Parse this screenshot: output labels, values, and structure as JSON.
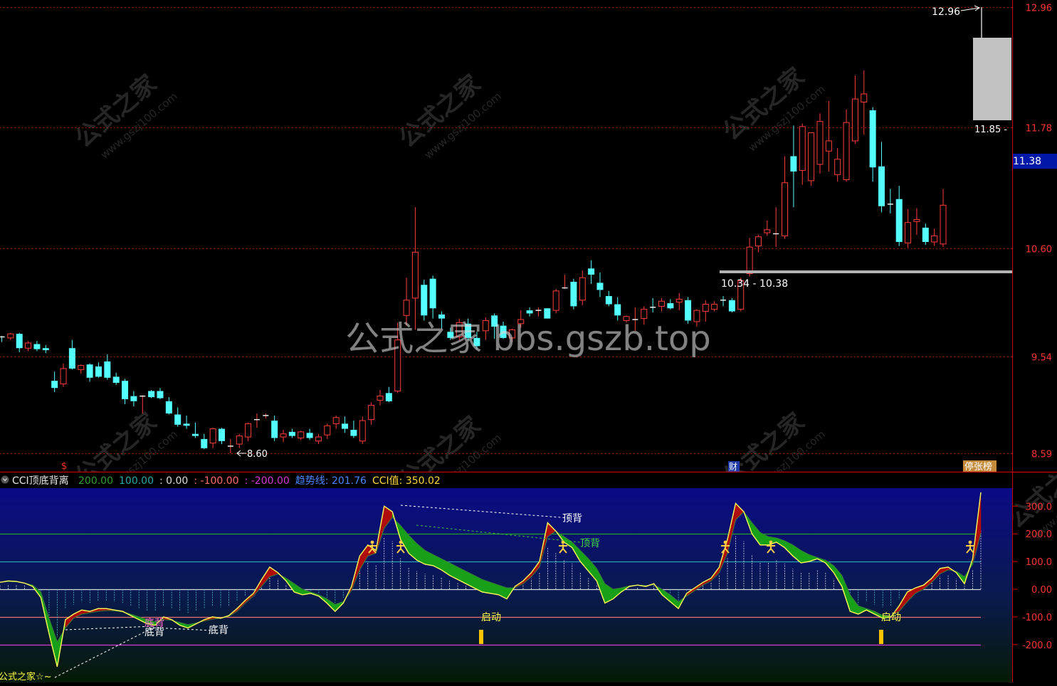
{
  "colors": {
    "up": "#ff3c3c",
    "down": "#54ffff",
    "axis": "#e00000",
    "grid": "#8b0000",
    "price_label": "#ff3434",
    "current_price_bg": "#0018a8",
    "indicator_bg_top": "#0a0a86",
    "indicator_bg_bottom": "#061a06",
    "cci_line": "#ffff55",
    "fill_up": "#b00c0c",
    "fill_down": "#18a018",
    "text_white": "#ffffff",
    "text_yellow": "#ffff44"
  },
  "price_panel": {
    "y_axis_labels": [
      "12.96",
      "11.78",
      "10.60",
      "9.54",
      "8.59"
    ],
    "current_price": "11.38",
    "high_marker": "12.96",
    "low_marker": "8.60",
    "level_marker": "11.85 -",
    "support_line_label": "10.34 - 10.38",
    "bottom_tags": {
      "left": "$",
      "mid": "财",
      "right": "停张榜"
    }
  },
  "watermark": {
    "main": "公式之家 bbs.gszb.top",
    "diagonal_cn": "公式之家",
    "diagonal_url": "www.gszj100.com"
  },
  "indicator_panel": {
    "title": "CCI顶底背离",
    "values": [
      {
        "text": "200.00",
        "color": "#2f9f2f"
      },
      {
        "text": "100.00",
        "color": "#27a7a7"
      },
      {
        "text": ": 0.00",
        "color": "#dddddd"
      },
      {
        "text": ": -100.00",
        "color": "#ff6a6a"
      },
      {
        "text": ": -200.00",
        "color": "#d23ad2"
      },
      {
        "text": "趋势线: 201.76",
        "color": "#4a86ff"
      },
      {
        "text": "CCI值: 350.02",
        "color": "#ffd93a"
      }
    ],
    "y_axis_labels": [
      "300.0",
      "200.0",
      "100.0",
      "0.00",
      "-100.0",
      "-200.0"
    ],
    "signals": {
      "top_divergence": "顶背",
      "bottom_divergence": "底背",
      "bottom_divergence_pink": "底背",
      "start": "启动"
    },
    "footer_label": "公式之家☆~"
  },
  "chart_data": [
    {
      "type": "candlestick",
      "title": "",
      "ylim": [
        8.5,
        13.1
      ],
      "y_ticks": [
        12.96,
        11.78,
        10.6,
        9.54,
        8.59
      ],
      "x": [
        1,
        2,
        3,
        4,
        5,
        6,
        7,
        8,
        9,
        10,
        11,
        12,
        13,
        14,
        15,
        16,
        17,
        18,
        19,
        20,
        21,
        22,
        23,
        24,
        25,
        26,
        27,
        28,
        29,
        30,
        31,
        32,
        33,
        34,
        35,
        36,
        37,
        38,
        39,
        40,
        41,
        42,
        43,
        44,
        45,
        46,
        47,
        48,
        49,
        50,
        51,
        52,
        53,
        54,
        55,
        56,
        57,
        58,
        59,
        60,
        61,
        62,
        63,
        64,
        65,
        66,
        67,
        68,
        69,
        70,
        71,
        72,
        73,
        74,
        75,
        76,
        77,
        78,
        79,
        80,
        81,
        82,
        83,
        84,
        85,
        86,
        87,
        88,
        89,
        90,
        91,
        92,
        93,
        94,
        95,
        96,
        97,
        98,
        99,
        100,
        101,
        102,
        103,
        104,
        105,
        106,
        107,
        108,
        109,
        110,
        111
      ],
      "ohlc": [
        [
          9.73,
          9.74,
          9.68,
          9.72
        ],
        [
          9.72,
          9.77,
          9.7,
          9.76
        ],
        [
          9.76,
          9.77,
          9.58,
          9.62
        ],
        [
          9.62,
          9.69,
          9.59,
          9.67
        ],
        [
          9.66,
          9.69,
          9.59,
          9.61
        ],
        [
          9.62,
          9.65,
          9.57,
          9.6
        ],
        [
          9.3,
          9.39,
          9.19,
          9.23
        ],
        [
          9.27,
          9.47,
          9.24,
          9.42
        ],
        [
          9.62,
          9.7,
          9.41,
          9.42
        ],
        [
          9.41,
          9.46,
          9.37,
          9.45
        ],
        [
          9.46,
          9.47,
          9.29,
          9.33
        ],
        [
          9.44,
          9.48,
          9.33,
          9.34
        ],
        [
          9.49,
          9.56,
          9.31,
          9.33
        ],
        [
          9.34,
          9.38,
          9.26,
          9.28
        ],
        [
          9.3,
          9.32,
          9.07,
          9.12
        ],
        [
          9.15,
          9.2,
          9.05,
          9.1
        ],
        [
          9.15,
          9.16,
          8.98,
          9.15
        ],
        [
          9.2,
          9.21,
          9.13,
          9.14
        ],
        [
          9.2,
          9.23,
          9.12,
          9.13
        ],
        [
          9.1,
          9.14,
          8.97,
          8.98
        ],
        [
          8.97,
          9.04,
          8.85,
          8.87
        ],
        [
          8.88,
          8.96,
          8.83,
          8.86
        ],
        [
          8.78,
          8.89,
          8.74,
          8.76
        ],
        [
          8.73,
          8.78,
          8.63,
          8.64
        ],
        [
          8.69,
          8.84,
          8.64,
          8.83
        ],
        [
          8.83,
          8.84,
          8.68,
          8.71
        ],
        [
          8.65,
          8.73,
          8.59,
          8.66
        ],
        [
          8.68,
          8.78,
          8.64,
          8.76
        ],
        [
          8.75,
          8.89,
          8.71,
          8.88
        ],
        [
          8.92,
          8.98,
          8.84,
          8.92
        ],
        [
          8.96,
          8.98,
          8.93,
          8.96
        ],
        [
          8.91,
          8.96,
          8.71,
          8.74
        ],
        [
          8.75,
          8.82,
          8.7,
          8.78
        ],
        [
          8.8,
          8.83,
          8.74,
          8.76
        ],
        [
          8.74,
          8.81,
          8.72,
          8.8
        ],
        [
          8.79,
          8.83,
          8.72,
          8.74
        ],
        [
          8.71,
          8.78,
          8.68,
          8.75
        ],
        [
          8.77,
          8.88,
          8.73,
          8.86
        ],
        [
          8.88,
          8.96,
          8.83,
          8.94
        ],
        [
          8.88,
          8.95,
          8.79,
          8.83
        ],
        [
          8.82,
          8.91,
          8.74,
          8.76
        ],
        [
          8.71,
          8.95,
          8.68,
          8.91
        ],
        [
          8.92,
          9.09,
          8.87,
          9.06
        ],
        [
          9.11,
          9.21,
          9.06,
          9.15
        ],
        [
          9.18,
          9.24,
          9.09,
          9.1
        ],
        [
          9.2,
          9.87,
          9.18,
          9.7
        ],
        [
          9.94,
          10.31,
          9.84,
          10.09
        ],
        [
          10.11,
          11.0,
          9.8,
          10.56
        ],
        [
          10.24,
          10.29,
          9.89,
          9.94
        ],
        [
          10.3,
          10.33,
          9.91,
          10.01
        ],
        [
          9.95,
          9.98,
          9.81,
          9.91
        ],
        [
          9.78,
          9.82,
          9.7,
          9.72
        ],
        [
          9.73,
          9.91,
          9.7,
          9.87
        ],
        [
          9.86,
          9.91,
          9.7,
          9.72
        ],
        [
          9.72,
          9.78,
          9.61,
          9.64
        ],
        [
          9.79,
          9.92,
          9.7,
          9.89
        ],
        [
          9.94,
          9.96,
          9.71,
          9.83
        ],
        [
          9.84,
          9.88,
          9.71,
          9.72
        ],
        [
          9.72,
          9.81,
          9.68,
          9.8
        ],
        [
          9.86,
          9.99,
          9.82,
          9.9
        ],
        [
          9.99,
          10.02,
          9.93,
          9.96
        ],
        [
          9.99,
          10.02,
          9.93,
          9.99
        ],
        [
          10.01,
          10.01,
          9.91,
          9.91
        ],
        [
          9.99,
          10.2,
          9.96,
          10.18
        ],
        [
          10.21,
          10.34,
          10.2,
          10.21
        ],
        [
          10.27,
          10.3,
          10.0,
          10.03
        ],
        [
          10.09,
          10.38,
          10.04,
          10.31
        ],
        [
          10.4,
          10.48,
          10.25,
          10.34
        ],
        [
          10.26,
          10.36,
          10.12,
          10.19
        ],
        [
          10.13,
          10.18,
          10.03,
          10.05
        ],
        [
          10.05,
          10.12,
          9.89,
          9.94
        ],
        [
          9.89,
          9.94,
          9.87,
          9.93
        ],
        [
          9.89,
          10.02,
          9.79,
          9.9
        ],
        [
          9.91,
          10.03,
          9.85,
          10.0
        ],
        [
          10.02,
          10.11,
          9.97,
          10.01
        ],
        [
          10.03,
          10.11,
          9.98,
          10.08
        ],
        [
          10.06,
          10.1,
          10.0,
          10.01
        ],
        [
          10.07,
          10.16,
          9.99,
          10.1
        ],
        [
          10.09,
          10.12,
          9.86,
          9.89
        ],
        [
          9.88,
          10.0,
          9.83,
          9.99
        ],
        [
          9.98,
          10.09,
          9.88,
          10.05
        ],
        [
          10.0,
          10.08,
          9.98,
          10.05
        ],
        [
          10.09,
          10.13,
          10.03,
          10.08
        ],
        [
          10.09,
          10.11,
          9.97,
          9.98
        ],
        [
          10.0,
          10.31,
          9.98,
          10.28
        ],
        [
          10.35,
          10.7,
          10.32,
          10.61
        ],
        [
          10.62,
          10.73,
          10.56,
          10.71
        ],
        [
          10.75,
          10.87,
          10.72,
          10.78
        ],
        [
          10.74,
          11.0,
          10.61,
          10.74
        ],
        [
          10.72,
          11.5,
          10.69,
          11.24
        ],
        [
          11.5,
          11.8,
          11.0,
          11.35
        ],
        [
          11.36,
          11.82,
          11.22,
          11.79
        ],
        [
          11.26,
          11.72,
          11.21,
          11.73
        ],
        [
          11.42,
          11.92,
          11.33,
          11.84
        ],
        [
          11.55,
          12.04,
          11.35,
          11.65
        ],
        [
          11.32,
          11.58,
          11.25,
          11.47
        ],
        [
          11.27,
          11.96,
          11.25,
          11.83
        ],
        [
          11.65,
          12.29,
          11.62,
          12.06
        ],
        [
          12.03,
          12.34,
          11.71,
          12.11
        ],
        [
          11.95,
          11.98,
          11.25,
          11.39
        ],
        [
          11.4,
          11.64,
          10.95,
          11.01
        ],
        [
          11.03,
          11.18,
          10.94,
          11.02
        ],
        [
          11.08,
          11.21,
          10.62,
          10.66
        ],
        [
          10.65,
          10.98,
          10.6,
          10.85
        ],
        [
          10.86,
          10.99,
          10.73,
          10.88
        ],
        [
          10.8,
          10.84,
          10.63,
          10.66
        ],
        [
          10.66,
          10.79,
          10.62,
          10.72
        ],
        [
          10.64,
          11.18,
          10.61,
          11.02
        ]
      ]
    },
    {
      "type": "area",
      "title": "CCI顶底背离",
      "ylim": [
        -330,
        370
      ],
      "y_ticks": [
        300,
        200,
        100,
        0,
        -100,
        -200
      ],
      "series": [
        {
          "name": "CCI值",
          "values": [
            25,
            30,
            28,
            22,
            10,
            -30,
            -160,
            -280,
            -110,
            -90,
            -75,
            -80,
            -70,
            -70,
            -75,
            -80,
            -95,
            -110,
            -125,
            -130,
            -100,
            -110,
            -130,
            -140,
            -125,
            -110,
            -100,
            -105,
            -95,
            -70,
            -40,
            -15,
            35,
            80,
            60,
            30,
            -10,
            -20,
            -15,
            -25,
            -50,
            -80,
            -50,
            10,
            120,
            160,
            140,
            300,
            280,
            180,
            130,
            105,
            90,
            85,
            70,
            50,
            35,
            20,
            5,
            -10,
            -15,
            -20,
            -35,
            10,
            30,
            60,
            100,
            240,
            210,
            170,
            150,
            100,
            65,
            30,
            -50,
            -35,
            -10,
            10,
            15,
            10,
            20,
            -20,
            -45,
            -70,
            -15,
            5,
            25,
            40,
            80,
            180,
            310,
            280,
            200,
            160,
            160,
            170,
            150,
            120,
            95,
            100,
            110,
            95,
            60,
            10,
            -80,
            -90,
            -75,
            -90,
            -105,
            -100,
            -60,
            -10,
            5,
            15,
            40,
            75,
            80,
            60,
            20,
            110,
            350
          ],
          "trend": [
            25,
            28,
            27,
            22,
            15,
            -10,
            -105,
            -190,
            -140,
            -105,
            -90,
            -85,
            -80,
            -77,
            -78,
            -82,
            -90,
            -100,
            -110,
            -118,
            -110,
            -112,
            -120,
            -128,
            -122,
            -115,
            -108,
            -105,
            -98,
            -80,
            -50,
            -25,
            10,
            45,
            55,
            40,
            20,
            0,
            -10,
            -20,
            -35,
            -55,
            -45,
            -5,
            70,
            120,
            130,
            220,
            260,
            230,
            195,
            165,
            140,
            125,
            110,
            95,
            80,
            65,
            50,
            35,
            25,
            15,
            5,
            5,
            20,
            45,
            80,
            190,
            210,
            190,
            170,
            140,
            110,
            75,
            20,
            0,
            5,
            12,
            15,
            13,
            16,
            0,
            -20,
            -45,
            -25,
            -5,
            15,
            30,
            60,
            130,
            250,
            280,
            240,
            205,
            190,
            185,
            175,
            160,
            140,
            125,
            115,
            105,
            85,
            50,
            -20,
            -60,
            -70,
            -80,
            -95,
            -98,
            -80,
            -45,
            -15,
            0,
            25,
            55,
            70,
            65,
            45,
            90,
            201.76
          ]
        }
      ]
    }
  ]
}
